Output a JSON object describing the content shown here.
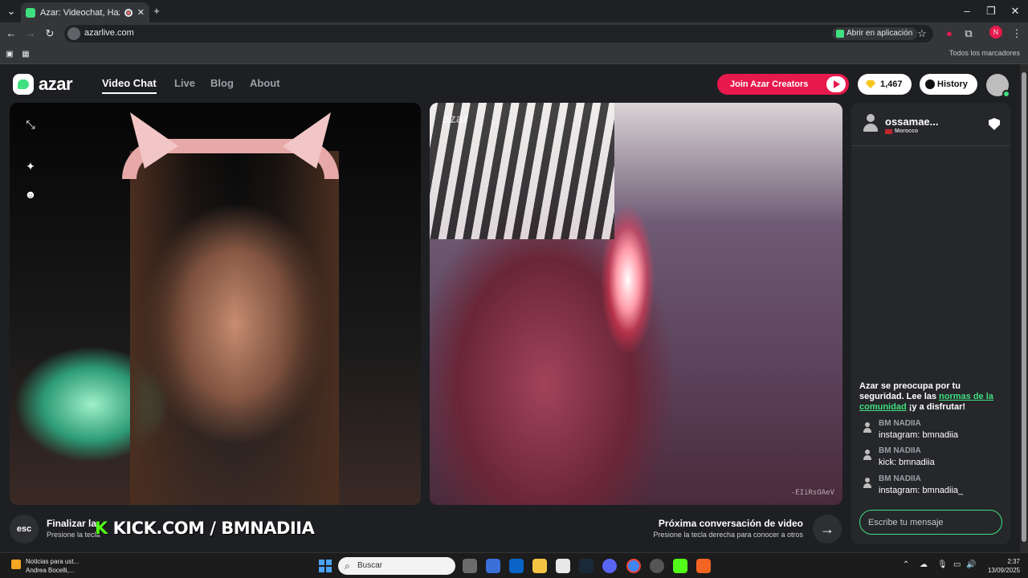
{
  "browser": {
    "tab_title": "Azar: Videochat, Haz nuevo",
    "url": "azarlive.com",
    "open_in_app": "Abrir en aplicación",
    "all_bookmarks": "Todos los marcadores",
    "profile_initial": "N"
  },
  "header": {
    "logo_text": "azar",
    "nav": [
      "Video Chat",
      "Live",
      "Blog",
      "About"
    ],
    "creators_label": "Join Azar Creators",
    "gems_count": "1,467",
    "history_label": "History"
  },
  "video": {
    "watermark_logo": "azar",
    "watermark_id": "-EIiRsOAeV"
  },
  "overlay": {
    "kick_k": "K",
    "kick_text": "KICK.COM / BMNADIIA"
  },
  "bottom": {
    "esc_label": "esc",
    "end_title": "Finalizar la",
    "end_sub": "Presione la tecla",
    "next_title": "Próxima conversación de video",
    "next_sub": "Presione la tecla derecha para conocer a otros"
  },
  "chat": {
    "partner_name": "ossamae...",
    "partner_country": "Morocco",
    "safety_text_1": "Azar se preocupa por tu seguridad. Lee las ",
    "safety_link": "normas de la comunidad",
    "safety_text_2": " ¡y a disfrutar!",
    "messages": [
      {
        "sender": "BM NADIIA",
        "text": "instagram: bmnadiia"
      },
      {
        "sender": "BM NADIIA",
        "text": "kick: bmnadiia"
      },
      {
        "sender": "BM NADIIA",
        "text": "instagram: bmnadiia_"
      }
    ],
    "input_placeholder": "Escribe tu mensaje"
  },
  "taskbar": {
    "news_title": "Noticias para ust...",
    "news_sub": "Andrea Bocelli,...",
    "search_placeholder": "Buscar",
    "time": "2:37",
    "date": "13/09/2025"
  },
  "colors": {
    "accent": "#3fe07f",
    "creators_red": "#e8194c",
    "kick_green": "#53fc18"
  }
}
